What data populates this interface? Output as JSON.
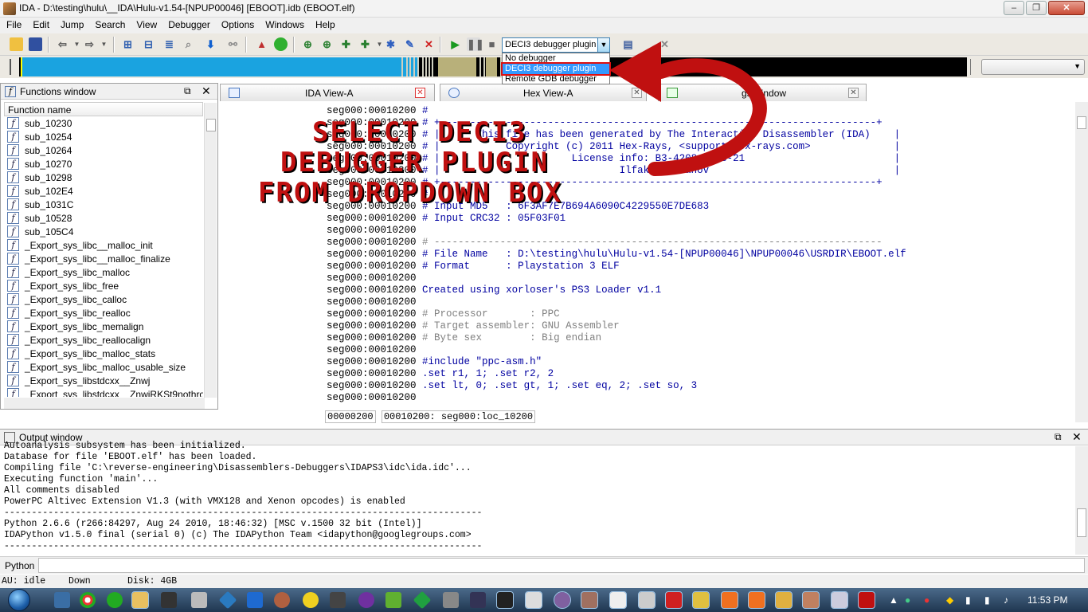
{
  "window": {
    "title": "IDA - D:\\testing\\hulu\\__IDA\\Hulu-v1.54-[NPUP00046] [EBOOT].idb (EBOOT.elf)",
    "minimize": "–",
    "maximize": "❐",
    "close": "✕"
  },
  "menu": [
    "File",
    "Edit",
    "Jump",
    "Search",
    "View",
    "Debugger",
    "Options",
    "Windows",
    "Help"
  ],
  "toolbar": {
    "debugger_select": "DECI3 debugger plugin",
    "debugger_options": [
      "No debugger",
      "DECI3 debugger plugin",
      "Remote GDB debugger"
    ]
  },
  "functions_window": {
    "title": "Functions window",
    "column": "Function name",
    "functions": [
      "sub_10230",
      "sub_10254",
      "sub_10264",
      "sub_10270",
      "sub_10298",
      "sub_102E4",
      "sub_1031C",
      "sub_10528",
      "sub_105C4",
      "_Export_sys_libc__malloc_init",
      "_Export_sys_libc__malloc_finalize",
      "_Export_sys_libc_malloc",
      "_Export_sys_libc_free",
      "_Export_sys_libc_calloc",
      "_Export_sys_libc_realloc",
      "_Export_sys_libc_memalign",
      "_Export_sys_libc_reallocalign",
      "_Export_sys_libc_malloc_stats",
      "_Export_sys_libc_malloc_usable_size",
      "_Export_sys_libstdcxx__Znwj",
      "_Export_sys_libstdcxx__ZnwjRKSt9nothrow"
    ],
    "icon_glyph": "f"
  },
  "tabs": {
    "ida_view": "IDA View-A",
    "hex_view": "Hex View-A",
    "strings": "gs window"
  },
  "overlay": {
    "line1": "SELECT DECI3",
    "line2": "DEBUGGER PLUGIN",
    "line3": "FROM DROPDOWN BOX"
  },
  "disasm": {
    "addr": "seg000:00010200",
    "lines": [
      "#",
      "# +-------------------------------------------------------------------------+",
      "# |      This file has been generated by The Interactive Disassembler (IDA)    |",
      "# |           Copyright (c) 2011 Hex-Rays, <support@hex-rays.com>              |",
      "# |                      License info: B3-4208-7C08-21                         |",
      "# |                              Ilfak Guilfanov                               |",
      "# +-------------------------------------------------------------------------+",
      "#",
      "# Input MD5   : 6F3AF7E7B694A6090C4229550E7DE683",
      "# Input CRC32 : 05F03F01",
      "",
      "# ---------------------------------------------------------------------------",
      "# File Name   : D:\\testing\\hulu\\Hulu-v1.54-[NPUP00046]\\NPUP00046\\USRDIR\\EBOOT.elf",
      "# Format      : Playstation 3 ELF",
      "",
      "Created using xorloser's PS3 Loader v1.1",
      "",
      "# Processor       : PPC",
      "# Target assembler: GNU Assembler",
      "# Byte sex        : Big endian",
      "",
      "#include \"ppc-asm.h\"",
      ".set r1, 1; .set r2, 2",
      ".set lt, 0; .set gt, 1; .set eq, 2; .set so, 3",
      ""
    ],
    "status_offset": "00000200",
    "status_loc": "00010200: seg000:loc_10200"
  },
  "output_window": {
    "title": "Output window",
    "lines": [
      "Autoanalysis subsystem has been initialized.",
      "Database for file 'EBOOT.elf' has been loaded.",
      "Compiling file 'C:\\reverse-engineering\\Disassemblers-Debuggers\\IDAPS3\\idc\\ida.idc'...",
      "Executing function 'main'...",
      "All comments disabled",
      "PowerPC Altivec Extension V1.3 (with VMX128 and Xenon opcodes) is enabled",
      "---------------------------------------------------------------------------------------",
      "Python 2.6.6 (r266:84297, Aug 24 2010, 18:46:32) [MSC v.1500 32 bit (Intel)]",
      "IDAPython v1.5.0 final (serial 0) (c) The IDAPython Team <idapython@googlegroups.com>",
      "---------------------------------------------------------------------------------------"
    ],
    "python_label": "Python"
  },
  "status": {
    "au": "AU:  idle",
    "dir": "Down",
    "disk": "Disk: 4GB"
  },
  "taskbar": {
    "clock": "11:53 PM"
  },
  "colors": {
    "disasm_comment": "#0000a0",
    "nav_blue": "#1aa3e0",
    "overlay_red": "#c01010",
    "arrow_red": "#e01010"
  }
}
